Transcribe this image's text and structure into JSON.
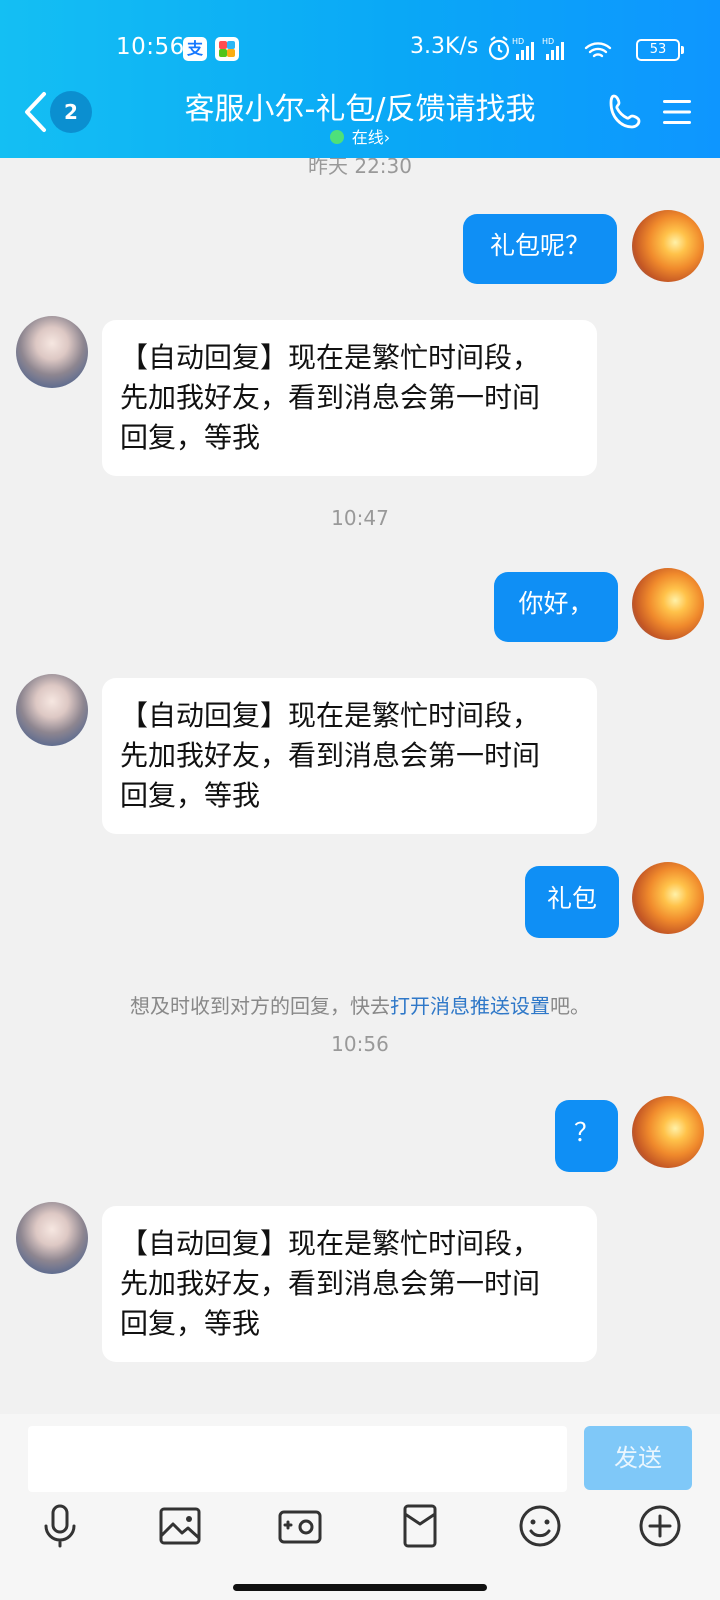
{
  "status_bar": {
    "time": "10:56",
    "network_speed": "3.3K/s",
    "battery": "53",
    "app_icon_1": "支",
    "icons": [
      "alarm-icon",
      "signal-hd-icon",
      "signal-hd-icon",
      "wifi-icon",
      "battery-icon"
    ]
  },
  "header": {
    "unread_count": "2",
    "title": "客服小尔-礼包/反馈请找我",
    "online_status": "在线",
    "online_chevron": "›",
    "online_dot_color": "#4ee07a",
    "accent_color": "#0aa8f6"
  },
  "chat": {
    "messages": [
      {
        "type": "time",
        "text": "昨天 22:30"
      },
      {
        "type": "out",
        "text": "礼包呢？"
      },
      {
        "type": "in",
        "lines": [
          "【自动回复】现在是繁忙时间段，",
          "先加我好友，看到消息会第一时间",
          "回复，等我"
        ]
      },
      {
        "type": "time",
        "text": "10:47"
      },
      {
        "type": "out",
        "text": "你好，"
      },
      {
        "type": "in",
        "lines": [
          "【自动回复】现在是繁忙时间段，",
          "先加我好友，看到消息会第一时间",
          "回复，等我"
        ]
      },
      {
        "type": "out",
        "text": "礼包"
      },
      {
        "type": "notice",
        "prefix": "想及时收到对方的回复，快去",
        "link": "打开消息推送设置",
        "suffix": "吧。"
      },
      {
        "type": "time",
        "text": "10:56"
      },
      {
        "type": "out",
        "text": "？"
      },
      {
        "type": "in",
        "lines": [
          "【自动回复】现在是繁忙时间段，",
          "先加我好友，看到消息会第一时间",
          "回复，等我"
        ]
      }
    ]
  },
  "input_bar": {
    "placeholder": "",
    "send_label": "发送",
    "tools": [
      "voice-icon",
      "image-icon",
      "camera-icon",
      "red-packet-icon",
      "emoji-icon",
      "plus-icon"
    ]
  }
}
